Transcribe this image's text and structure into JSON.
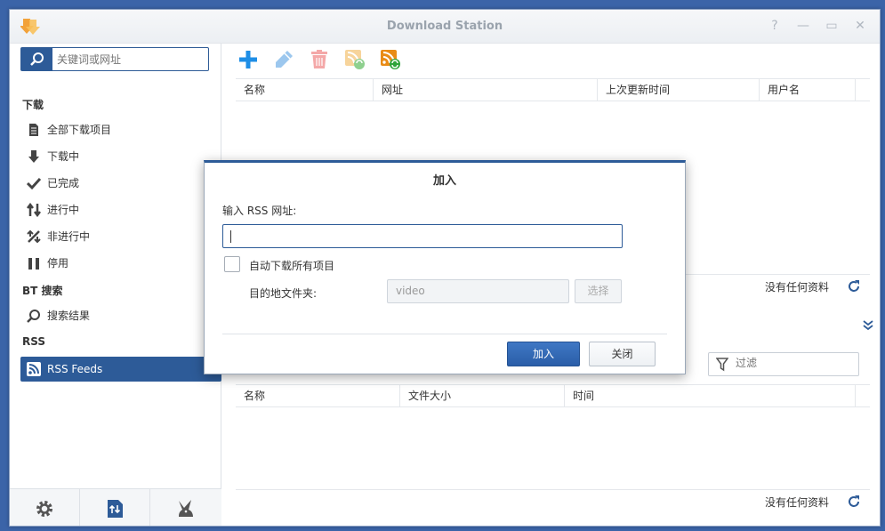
{
  "window": {
    "title": "Download Station",
    "controls": {
      "help": "?",
      "minimize": "—",
      "maximize": "▭",
      "close": "✕"
    }
  },
  "sidebar": {
    "search_placeholder": "关键词或网址",
    "download_section": "下载",
    "items": [
      {
        "label": "全部下载项目",
        "icon": "all-downloads-icon"
      },
      {
        "label": "下载中",
        "icon": "downloading-icon"
      },
      {
        "label": "已完成",
        "icon": "completed-icon"
      },
      {
        "label": "进行中",
        "icon": "active-icon"
      },
      {
        "label": "非进行中",
        "icon": "inactive-icon"
      },
      {
        "label": "停用",
        "icon": "paused-icon"
      }
    ],
    "bt_section": "BT 搜索",
    "bt_items": [
      {
        "label": "搜索结果",
        "icon": "search-icon"
      }
    ],
    "rss_section": "RSS",
    "rss_items": [
      {
        "label": "RSS Feeds",
        "icon": "rss-icon",
        "active": true
      }
    ],
    "bottom_buttons": [
      "settings-icon",
      "transfer-icon",
      "emule-icon"
    ]
  },
  "toolbar": {
    "buttons": [
      "add-icon",
      "edit-icon",
      "delete-icon",
      "refresh-feed-icon",
      "update-all-feeds-icon"
    ]
  },
  "top_grid": {
    "columns": [
      "名称",
      "网址",
      "上次更新时间",
      "用户名"
    ],
    "status": "没有任何资料"
  },
  "bottom_grid": {
    "filter_placeholder": "过滤",
    "columns": [
      "名称",
      "文件大小",
      "时间"
    ],
    "status": "没有任何资料"
  },
  "dialog": {
    "title": "加入",
    "url_label": "输入 RSS 网址:",
    "url_value": "",
    "auto_download_label": "自动下载所有项目",
    "auto_download_checked": false,
    "destination_label": "目的地文件夹:",
    "destination_value": "video",
    "choose_label": "选择",
    "ok_label": "加入",
    "close_label": "关闭"
  },
  "colors": {
    "accent": "#2d5b98",
    "desktop": "#3b64a8",
    "add": "#1e8ee6",
    "delete": "#f08c8c"
  }
}
